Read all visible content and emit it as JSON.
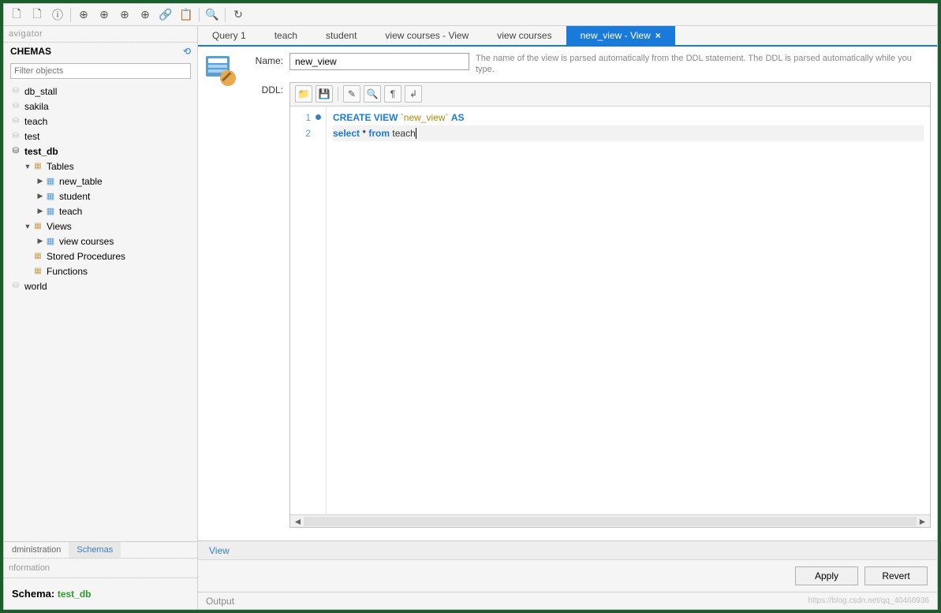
{
  "navigator": {
    "label": "avigator",
    "schemas_label": "CHEMAS",
    "filter_placeholder": "Filter objects"
  },
  "tree": {
    "databases": [
      {
        "name": "db_stall",
        "expanded": false,
        "active": false
      },
      {
        "name": "sakila",
        "expanded": false,
        "active": false
      },
      {
        "name": "teach",
        "expanded": false,
        "active": false
      },
      {
        "name": "test",
        "expanded": false,
        "active": false
      },
      {
        "name": "test_db",
        "expanded": true,
        "active": true,
        "children": [
          {
            "name": "Tables",
            "type": "folder",
            "expanded": true,
            "children": [
              {
                "name": "new_table",
                "type": "table"
              },
              {
                "name": "student",
                "type": "table"
              },
              {
                "name": "teach",
                "type": "table"
              }
            ]
          },
          {
            "name": "Views",
            "type": "folder",
            "expanded": true,
            "children": [
              {
                "name": "view courses",
                "type": "view"
              }
            ]
          },
          {
            "name": "Stored Procedures",
            "type": "folder",
            "expanded": false
          },
          {
            "name": "Functions",
            "type": "folder",
            "expanded": false
          }
        ]
      },
      {
        "name": "world",
        "expanded": false,
        "active": false
      }
    ]
  },
  "sidebar_tabs": {
    "admin": "dministration",
    "schemas": "Schemas"
  },
  "info": {
    "label": "nformation",
    "schema_label": "Schema:",
    "schema_value": "test_db"
  },
  "tabs": [
    {
      "label": "Query 1"
    },
    {
      "label": "teach"
    },
    {
      "label": "student"
    },
    {
      "label": "view courses - View"
    },
    {
      "label": "view courses"
    },
    {
      "label": "new_view - View",
      "active": true,
      "closable": true
    }
  ],
  "form": {
    "name_label": "Name:",
    "name_value": "new_view",
    "ddl_label": "DDL:",
    "hint": "The name of the view is parsed automatically from the DDL statement. The DDL is parsed automatically while you type."
  },
  "code": {
    "lines": [
      {
        "n": 1,
        "bp": true,
        "tokens": [
          {
            "t": "CREATE VIEW",
            "c": "kw"
          },
          {
            "t": " "
          },
          {
            "t": "`new_view`",
            "c": "str"
          },
          {
            "t": " "
          },
          {
            "t": "AS",
            "c": "kw"
          }
        ]
      },
      {
        "n": 2,
        "bp": false,
        "hl": true,
        "tokens": [
          {
            "t": "select",
            "c": "kw"
          },
          {
            "t": " * "
          },
          {
            "t": "from",
            "c": "kw"
          },
          {
            "t": " "
          },
          {
            "t": "teach",
            "c": "id",
            "cursor": true
          }
        ]
      }
    ]
  },
  "bottom_tab": "View",
  "buttons": {
    "apply": "Apply",
    "revert": "Revert"
  },
  "output_label": "Output",
  "watermark": "https://blog.csdn.net/qq_40468936"
}
